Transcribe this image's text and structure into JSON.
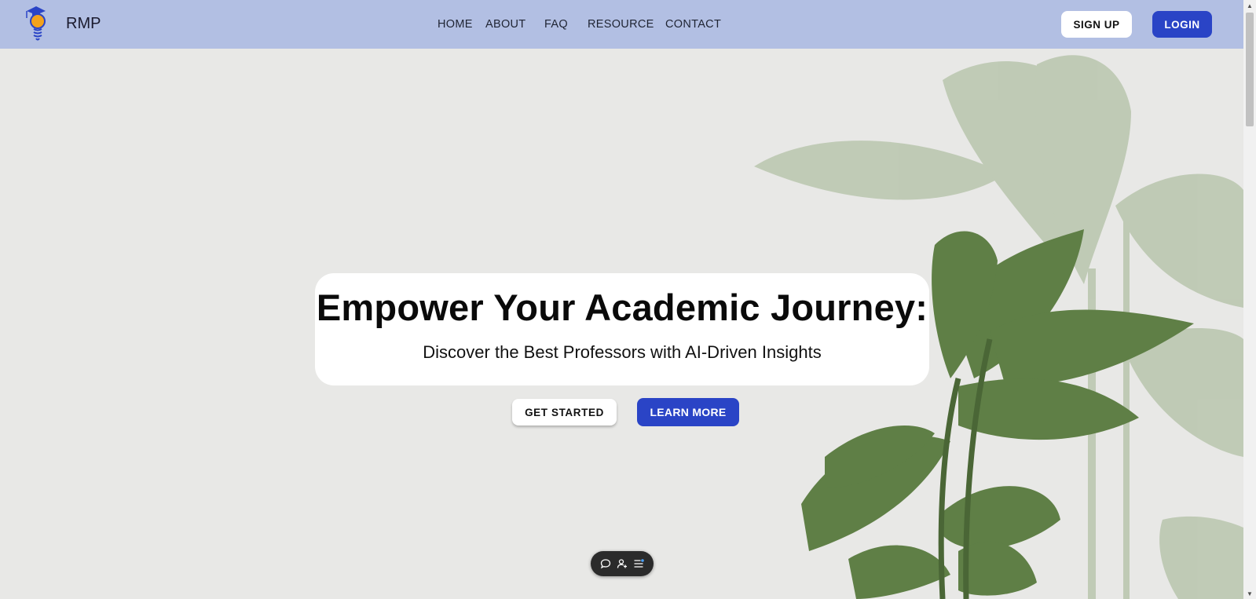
{
  "colors": {
    "navbar_bg": "#b2bfe3",
    "page_bg": "#e8e8e6",
    "primary_button": "#2a44c6",
    "plant_dark": "#5f7f46",
    "plant_light": "#b8c5ad"
  },
  "header": {
    "brand": "RMP",
    "logo_icon": "lightbulb-graduation-cap-icon",
    "nav": [
      "HOME",
      "ABOUT",
      "FAQ",
      "RESOURCE",
      "CONTACT"
    ],
    "signup_label": "SIGN UP",
    "login_label": "LOGIN"
  },
  "hero": {
    "title": "Empower Your Academic Journey:",
    "subtitle": "Discover the Best Professors with AI-Driven Insights",
    "get_started_label": "GET STARTED",
    "learn_more_label": "LEARN MORE"
  },
  "toolbar": {
    "icons": [
      "comment-icon",
      "add-user-icon",
      "list-settings-icon"
    ]
  }
}
